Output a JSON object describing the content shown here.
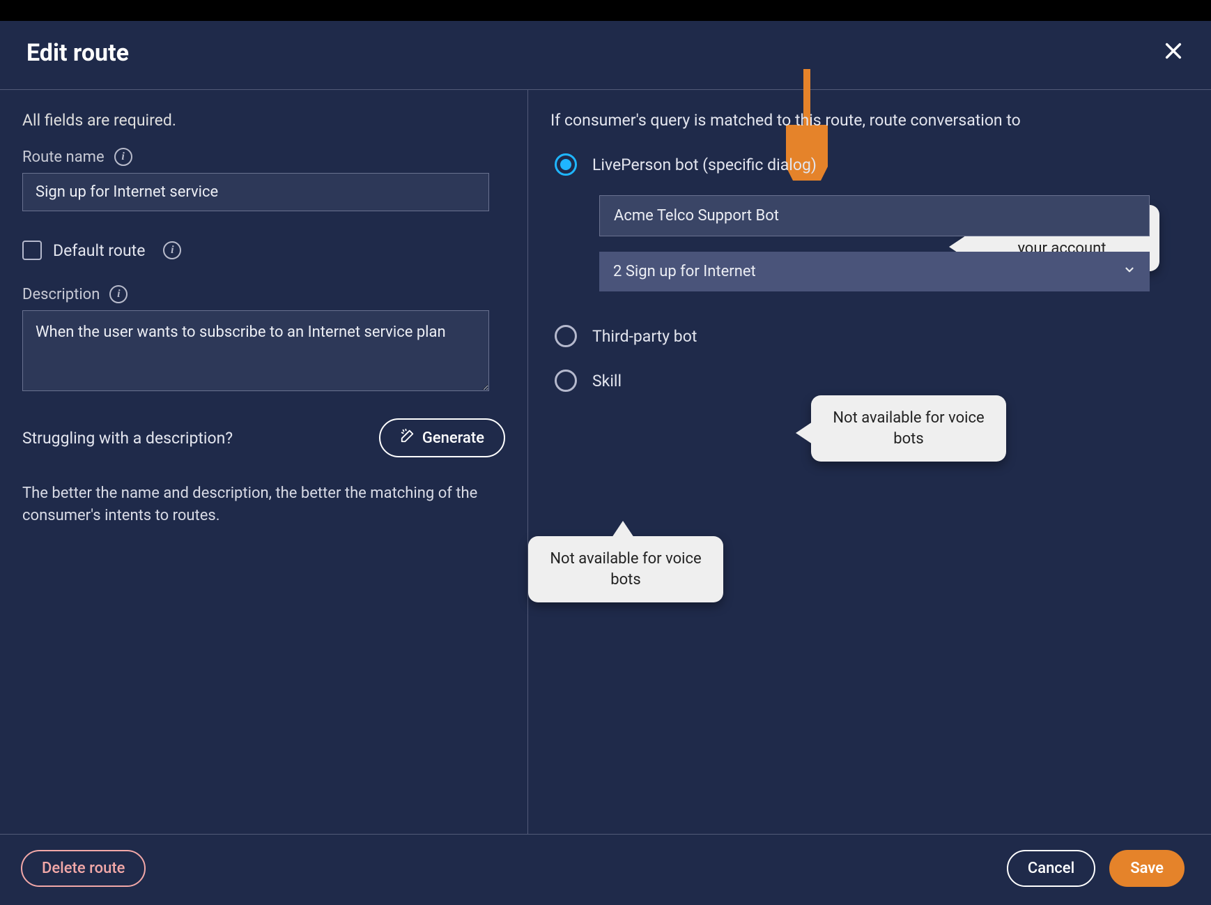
{
  "dialog": {
    "title": "Edit route",
    "close_label": "Close"
  },
  "left": {
    "required_note": "All fields are required.",
    "route_name_label": "Route name",
    "route_name_value": "Sign up for Internet service",
    "default_route_label": "Default route",
    "default_route_checked": false,
    "description_label": "Description",
    "description_value": "When the user wants to subscribe to an Internet service plan",
    "struggling_text": "Struggling with a description?",
    "generate_label": "Generate",
    "hint": "The better the name and description, the better the matching of the consumer's intents to routes."
  },
  "right": {
    "heading": "If consumer's query is matched to this route, route conversation to",
    "options": [
      {
        "id": "liveperson_bot",
        "label": "LivePerson bot (specific dialog)",
        "selected": true
      },
      {
        "id": "third_party_bot",
        "label": "Third-party bot",
        "selected": false
      },
      {
        "id": "skill",
        "label": "Skill",
        "selected": false
      }
    ],
    "bot_value": "Acme Telco Support Bot",
    "dialog_value": "2 Sign up for Internet"
  },
  "footer": {
    "delete_label": "Delete route",
    "cancel_label": "Cancel",
    "save_label": "Save"
  },
  "annotations": {
    "callout_bot": "Route to any bot in your account",
    "callout_third_party": "Not available for voice bots",
    "callout_skill": "Not available for voice bots"
  }
}
